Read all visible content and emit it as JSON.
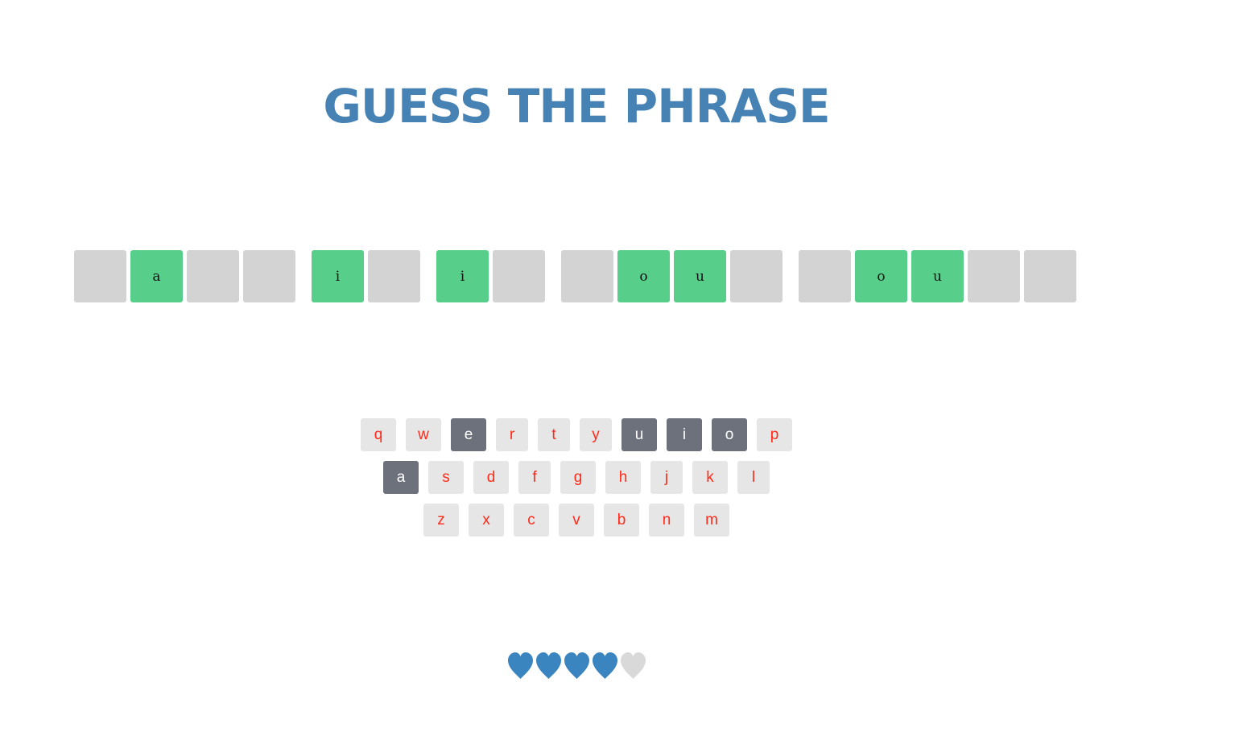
{
  "title": "GUESS THE PHRASE",
  "phrase": {
    "words": [
      [
        "",
        "a",
        "",
        ""
      ],
      [
        "i",
        ""
      ],
      [
        "i",
        ""
      ],
      [
        "",
        "o",
        "u",
        ""
      ],
      [
        "",
        "o",
        "u",
        "",
        ""
      ]
    ]
  },
  "keyboard": {
    "rows": [
      [
        {
          "key": "q",
          "used": false
        },
        {
          "key": "w",
          "used": false
        },
        {
          "key": "e",
          "used": true
        },
        {
          "key": "r",
          "used": false
        },
        {
          "key": "t",
          "used": false
        },
        {
          "key": "y",
          "used": false
        },
        {
          "key": "u",
          "used": true
        },
        {
          "key": "i",
          "used": true
        },
        {
          "key": "o",
          "used": true
        },
        {
          "key": "p",
          "used": false
        }
      ],
      [
        {
          "key": "a",
          "used": true
        },
        {
          "key": "s",
          "used": false
        },
        {
          "key": "d",
          "used": false
        },
        {
          "key": "f",
          "used": false
        },
        {
          "key": "g",
          "used": false
        },
        {
          "key": "h",
          "used": false
        },
        {
          "key": "j",
          "used": false
        },
        {
          "key": "k",
          "used": false
        },
        {
          "key": "l",
          "used": false
        }
      ],
      [
        {
          "key": "z",
          "used": false
        },
        {
          "key": "x",
          "used": false
        },
        {
          "key": "c",
          "used": false
        },
        {
          "key": "v",
          "used": false
        },
        {
          "key": "b",
          "used": false
        },
        {
          "key": "n",
          "used": false
        },
        {
          "key": "m",
          "used": false
        }
      ]
    ]
  },
  "lives": {
    "total": 5,
    "remaining": 4
  },
  "colors": {
    "title": "#4682b4",
    "tile_hidden": "#d3d3d3",
    "tile_revealed": "#57cf8a",
    "key_default_bg": "#e6e6e6",
    "key_default_text": "#ff2a1a",
    "key_used_bg": "#6d717b",
    "key_used_text": "#ffffff",
    "heart_full": "#3a84bf",
    "heart_empty": "#d9d9d9"
  },
  "icons": {
    "heart_full": "heart-icon",
    "heart_empty": "heart-empty-icon"
  }
}
